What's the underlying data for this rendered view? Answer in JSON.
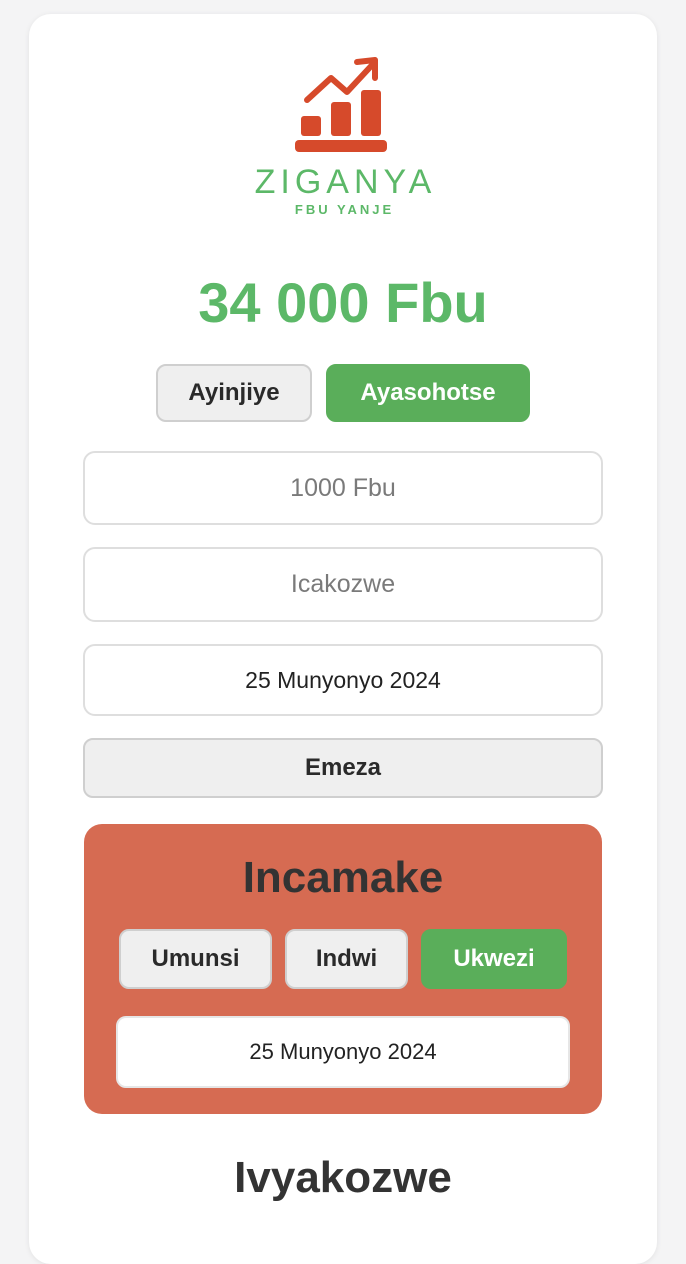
{
  "colors": {
    "accent_green": "#5cb868",
    "button_green": "#5aae5a",
    "logo_red": "#d64a2b",
    "summary_bg": "#d66b52"
  },
  "logo": {
    "icon": "rising-bar-chart-icon",
    "brand": "ZIGANYA",
    "tagline": "FBU YANJE"
  },
  "balance": "34 000 Fbu",
  "type_toggle": {
    "options": [
      "Ayinjiye",
      "Ayasohotse"
    ],
    "selected": "Ayasohotse"
  },
  "form": {
    "amount_placeholder": "1000 Fbu",
    "description_placeholder": "Icakozwe",
    "date_value": "25 Munyonyo 2024",
    "submit_label": "Emeza"
  },
  "summary": {
    "title": "Incamake",
    "periods": [
      "Umunsi",
      "Indwi",
      "Ukwezi"
    ],
    "selected": "Ukwezi",
    "date_value": "25 Munyonyo 2024"
  },
  "history": {
    "title": "Ivyakozwe"
  }
}
